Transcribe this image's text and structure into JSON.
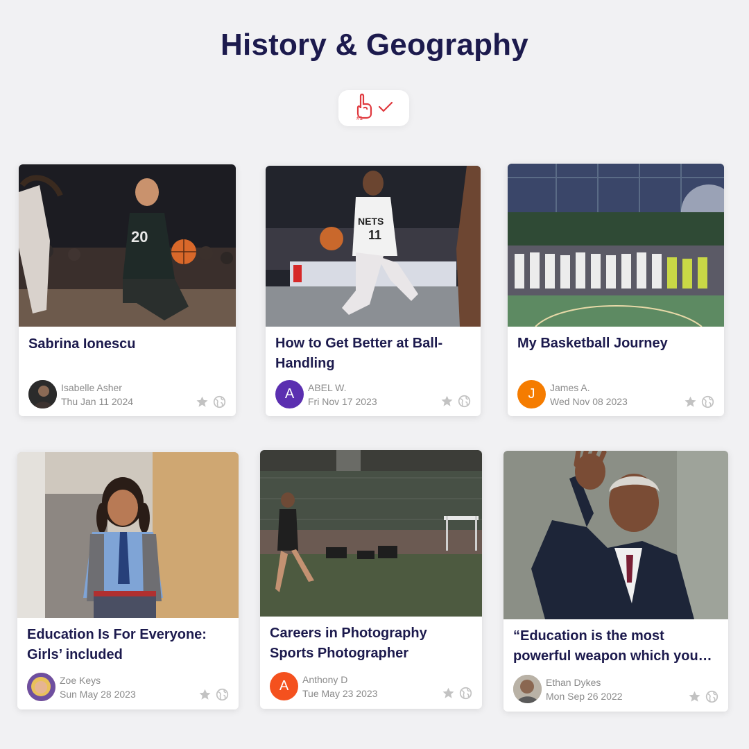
{
  "page": {
    "title": "History & Geography"
  },
  "badge": {
    "hand_icon": "number-one-hand-icon",
    "hand_text": "#1",
    "check_icon": "checkmark-icon",
    "color": "#e0393e"
  },
  "cards": [
    {
      "title": "Sabrina Ionescu",
      "author": "Isabelle Asher",
      "date": "Thu Jan 11 2024",
      "avatar_letter": "",
      "avatar_color": "#2b2b2b",
      "image": "basketball-player-dribbling-photo"
    },
    {
      "title": "How to Get Better at Ball-Handling",
      "author": "ABEL W.",
      "date": "Fri Nov 17 2023",
      "avatar_letter": "A",
      "avatar_color": "#5b2fb0",
      "image": "basketball-player-11-photo"
    },
    {
      "title": "My Basketball Journey",
      "author": "James A.",
      "date": "Wed Nov 08 2023",
      "avatar_letter": "J",
      "avatar_color": "#f57c00",
      "image": "youth-basketball-team-photo"
    },
    {
      "title": "Education Is For Everyone: Girls’ included",
      "author": "Zoe Keys",
      "date": "Sun May 28 2023",
      "avatar_letter": "",
      "avatar_color": "#c98a5e",
      "image": "schoolgirl-with-backpack-photo"
    },
    {
      "title": "Careers in Photography Sports Photographer",
      "author": "Anthony D",
      "date": "Tue May 23 2023",
      "avatar_letter": "A",
      "avatar_color": "#f4511e",
      "image": "track-runner-photo"
    },
    {
      "title": "“Education is the most powerful weapon which you…",
      "author": "Ethan Dykes",
      "date": "Mon Sep 26 2022",
      "avatar_letter": "",
      "avatar_color": "#8d8072",
      "image": "man-waving-photo"
    }
  ],
  "icons": {
    "star": "star-icon",
    "globe": "globe-icon",
    "icon_color": "#c2c2c2"
  }
}
